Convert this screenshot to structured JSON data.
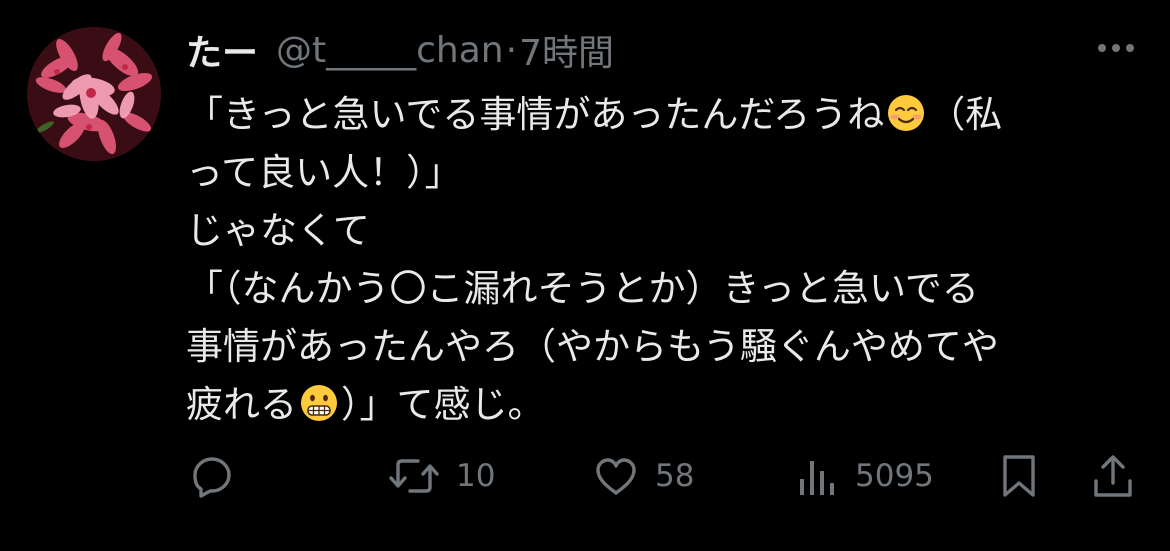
{
  "tweet": {
    "display_name": "たー",
    "handle": "@t_____chan",
    "separator": "·",
    "time": "7時間",
    "more_icon": "more-dots-icon",
    "body_lines": [
      {
        "before": "「きっと急いでる事情があったんだろうね",
        "emoji": "smiling-face-emoji",
        "after": "（私"
      },
      {
        "before": "って良い人！）」"
      },
      {
        "before": "じゃなくて"
      },
      {
        "before": "「（なんかう〇こ漏れそうとか）きっと急いでる"
      },
      {
        "before": "事情があったんやろ（やからもう騒ぐんやめてや"
      },
      {
        "before": "疲れる",
        "emoji": "grimacing-face-emoji",
        "after": "）」て感じ。"
      }
    ],
    "actions": {
      "reply": {
        "icon": "reply-icon",
        "count": ""
      },
      "retweet": {
        "icon": "retweet-icon",
        "count": "10"
      },
      "like": {
        "icon": "heart-icon",
        "count": "58"
      },
      "views": {
        "icon": "views-icon",
        "count": "5095"
      },
      "bookmark": {
        "icon": "bookmark-icon"
      },
      "share": {
        "icon": "share-icon"
      }
    },
    "colors": {
      "background": "#000000",
      "text": "#e7e9ea",
      "secondary": "#71767b"
    }
  }
}
